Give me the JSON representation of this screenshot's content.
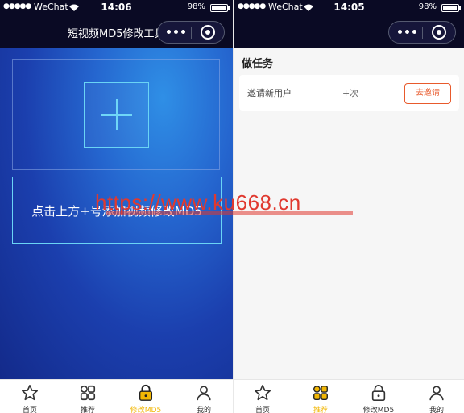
{
  "left": {
    "status": {
      "signal": "●●●●●",
      "carrier": "WeChat",
      "time": "14:06",
      "battery": "98%"
    },
    "nav": {
      "title": "短视频MD5修改工具"
    },
    "hint_text": "点击上方+号添加视频修改MD5",
    "tabs": [
      {
        "label": "首页",
        "icon": "star-icon"
      },
      {
        "label": "推荐",
        "icon": "grid-icon"
      },
      {
        "label": "修改MD5",
        "icon": "lock-icon",
        "active": true
      },
      {
        "label": "我的",
        "icon": "user-icon"
      }
    ]
  },
  "right": {
    "status": {
      "signal": "●●●●●",
      "carrier": "WeChat",
      "time": "14:05",
      "battery": "98%"
    },
    "section_title": "做任务",
    "task": {
      "name": "邀请新用户",
      "count": "+次",
      "button": "去邀请"
    },
    "tabs": [
      {
        "label": "首页",
        "icon": "star-icon"
      },
      {
        "label": "推荐",
        "icon": "grid-icon",
        "active": true
      },
      {
        "label": "修改MD5",
        "icon": "lock-icon"
      },
      {
        "label": "我的",
        "icon": "user-icon"
      }
    ]
  },
  "watermark": "https://www.ku668.cn",
  "colors": {
    "accent": "#f2b705",
    "invite": "#e85a2c",
    "navbar": "#0a0a24",
    "watermark": "#e0392f"
  }
}
